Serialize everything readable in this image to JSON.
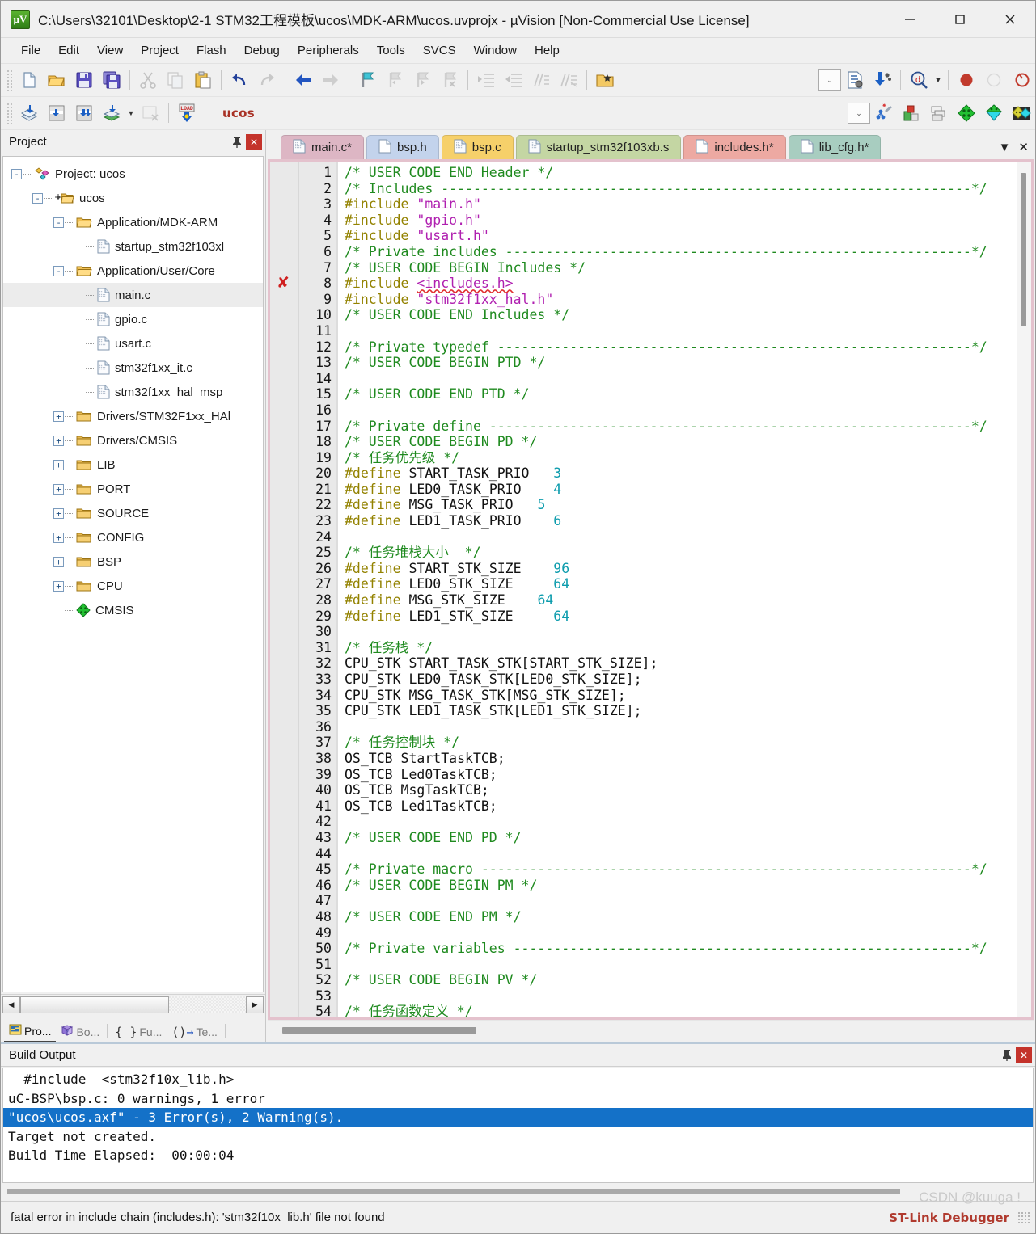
{
  "window": {
    "title": "C:\\Users\\32101\\Desktop\\2-1 STM32工程模板\\ucos\\MDK-ARM\\ucos.uvprojx - µVision  [Non-Commercial Use License]",
    "app_icon_text": "µV",
    "minimize": "—",
    "maximize": "▢",
    "close": "✕"
  },
  "menu": {
    "items": [
      "File",
      "Edit",
      "View",
      "Project",
      "Flash",
      "Debug",
      "Peripherals",
      "Tools",
      "SVCS",
      "Window",
      "Help"
    ]
  },
  "toolbar1": {
    "icons": [
      "new-file-icon",
      "open-folder-icon",
      "save-icon",
      "save-all-icon",
      "cut-icon",
      "copy-icon",
      "paste-icon",
      "undo-icon",
      "redo-icon",
      "navigate-back-icon",
      "navigate-forward-icon",
      "bookmark-toggle-icon",
      "bookmark-prev-icon",
      "bookmark-next-icon",
      "bookmark-clear-icon",
      "indent-icon",
      "outdent-icon",
      "comment-icon",
      "uncomment-icon",
      "open-in-explorer-icon",
      "configure-toolbar-icon",
      "debug-settings-icon",
      "download-icon",
      "find-icon",
      "find-dropdown-icon",
      "start-debug-icon",
      "stop-debug-icon",
      "insert-breakpoint-icon"
    ]
  },
  "toolbar2": {
    "icons": [
      "translate-icon",
      "build-icon",
      "rebuild-icon",
      "batch-build-icon",
      "batch-build-dropdown-icon",
      "stop-build-icon",
      "load-icon"
    ],
    "target_selector_value": "ucos",
    "target_dropdown": "⌄",
    "icons_right": [
      "target-options-icon",
      "manage-project-items-icon",
      "manage-multi-project-icon",
      "pack-installer-icon",
      "manage-runtime-env-icon",
      "pack-manage-icon"
    ]
  },
  "project_panel": {
    "title": "Project",
    "pin_icon": "📌",
    "close_label": "✕",
    "tree": [
      {
        "label": "Project: ucos",
        "depth": 0,
        "expander": "-",
        "icon": "project-icon"
      },
      {
        "label": "ucos",
        "depth": 1,
        "expander": "-",
        "icon": "target-folder-icon"
      },
      {
        "label": "Application/MDK-ARM",
        "depth": 2,
        "expander": "-",
        "icon": "open-folder-icon"
      },
      {
        "label": "startup_stm32f103xl",
        "depth": 3,
        "expander": "",
        "icon": "asm-file-icon"
      },
      {
        "label": "Application/User/Core",
        "depth": 2,
        "expander": "-",
        "icon": "open-folder-icon"
      },
      {
        "label": "main.c",
        "depth": 3,
        "expander": "",
        "icon": "c-file-icon",
        "selected": true
      },
      {
        "label": "gpio.c",
        "depth": 3,
        "expander": "",
        "icon": "c-file-icon"
      },
      {
        "label": "usart.c",
        "depth": 3,
        "expander": "",
        "icon": "c-file-icon"
      },
      {
        "label": "stm32f1xx_it.c",
        "depth": 3,
        "expander": "",
        "icon": "c-file-icon"
      },
      {
        "label": "stm32f1xx_hal_msp",
        "depth": 3,
        "expander": "",
        "icon": "c-file-icon"
      },
      {
        "label": "Drivers/STM32F1xx_HAl",
        "depth": 2,
        "expander": "+",
        "icon": "closed-folder-icon"
      },
      {
        "label": "Drivers/CMSIS",
        "depth": 2,
        "expander": "+",
        "icon": "closed-folder-icon"
      },
      {
        "label": "LIB",
        "depth": 2,
        "expander": "+",
        "icon": "closed-folder-icon"
      },
      {
        "label": "PORT",
        "depth": 2,
        "expander": "+",
        "icon": "closed-folder-icon"
      },
      {
        "label": "SOURCE",
        "depth": 2,
        "expander": "+",
        "icon": "closed-folder-icon"
      },
      {
        "label": "CONFIG",
        "depth": 2,
        "expander": "+",
        "icon": "closed-folder-icon"
      },
      {
        "label": "BSP",
        "depth": 2,
        "expander": "+",
        "icon": "closed-folder-icon"
      },
      {
        "label": "CPU",
        "depth": 2,
        "expander": "+",
        "icon": "closed-folder-icon"
      },
      {
        "label": "CMSIS",
        "depth": 2,
        "expander": "",
        "icon": "cmsis-icon"
      }
    ],
    "bottom_tabs": [
      {
        "label": "Pro...",
        "icon": "project-window-icon",
        "active": true
      },
      {
        "label": "Bo...",
        "icon": "books-icon",
        "active": false
      },
      {
        "label": "Fu...",
        "icon": "functions-icon",
        "active": false
      },
      {
        "label": "Te...",
        "icon": "templates-icon",
        "active": false
      }
    ]
  },
  "editor": {
    "tabs": [
      {
        "label": "main.c*",
        "color": "#ddb6c4",
        "active": true,
        "icon": "c-file-icon"
      },
      {
        "label": "bsp.h",
        "color": "#c3d3ec",
        "active": false,
        "icon": "h-file-icon"
      },
      {
        "label": "bsp.c",
        "color": "#f6d06a",
        "active": false,
        "icon": "c-file-icon"
      },
      {
        "label": "startup_stm32f103xb.s",
        "color": "#c4d6a3",
        "active": false,
        "icon": "asm-file-icon"
      },
      {
        "label": "includes.h*",
        "color": "#eda9a2",
        "active": false,
        "icon": "h-file-icon"
      },
      {
        "label": "lib_cfg.h*",
        "color": "#a8cdc0",
        "active": false,
        "icon": "h-file-icon"
      }
    ],
    "tab_list_button": "▼",
    "tab_close_button": "✕",
    "error_marker_line": 8,
    "first_line": 1,
    "lines": [
      {
        "n": 1,
        "tokens": [
          [
            "cm",
            "/* USER CODE END Header */"
          ]
        ]
      },
      {
        "n": 2,
        "tokens": [
          [
            "cm",
            "/* Includes ------------------------------------------------------------------*/"
          ]
        ]
      },
      {
        "n": 3,
        "tokens": [
          [
            "pp",
            "#include "
          ],
          [
            "str",
            "\"main.h\""
          ]
        ]
      },
      {
        "n": 4,
        "tokens": [
          [
            "pp",
            "#include "
          ],
          [
            "str",
            "\"gpio.h\""
          ]
        ]
      },
      {
        "n": 5,
        "tokens": [
          [
            "pp",
            "#include "
          ],
          [
            "str",
            "\"usart.h\""
          ]
        ]
      },
      {
        "n": 6,
        "tokens": [
          [
            "cm",
            "/* Private includes ----------------------------------------------------------*/"
          ]
        ]
      },
      {
        "n": 7,
        "tokens": [
          [
            "cm",
            "/* USER CODE BEGIN Includes */"
          ]
        ]
      },
      {
        "n": 8,
        "tokens": [
          [
            "pp",
            "#include "
          ],
          [
            "sq",
            "<includes.h>"
          ]
        ]
      },
      {
        "n": 9,
        "tokens": [
          [
            "pp",
            "#include "
          ],
          [
            "str",
            "\"stm32f1xx_hal.h\""
          ]
        ]
      },
      {
        "n": 10,
        "tokens": [
          [
            "cm",
            "/* USER CODE END Includes */"
          ]
        ]
      },
      {
        "n": 11,
        "tokens": []
      },
      {
        "n": 12,
        "tokens": [
          [
            "cm",
            "/* Private typedef -----------------------------------------------------------*/"
          ]
        ]
      },
      {
        "n": 13,
        "tokens": [
          [
            "cm",
            "/* USER CODE BEGIN PTD */"
          ]
        ]
      },
      {
        "n": 14,
        "tokens": []
      },
      {
        "n": 15,
        "tokens": [
          [
            "cm",
            "/* USER CODE END PTD */"
          ]
        ]
      },
      {
        "n": 16,
        "tokens": []
      },
      {
        "n": 17,
        "tokens": [
          [
            "cm",
            "/* Private define ------------------------------------------------------------*/"
          ]
        ]
      },
      {
        "n": 18,
        "tokens": [
          [
            "cm",
            "/* USER CODE BEGIN PD */"
          ]
        ]
      },
      {
        "n": 19,
        "tokens": [
          [
            "cm",
            "/* 任务优先级 */"
          ]
        ]
      },
      {
        "n": 20,
        "tokens": [
          [
            "pp",
            "#define"
          ],
          [
            "",
            " START_TASK_PRIO   "
          ],
          [
            "num",
            "3"
          ]
        ]
      },
      {
        "n": 21,
        "tokens": [
          [
            "pp",
            "#define"
          ],
          [
            "",
            " LED0_TASK_PRIO    "
          ],
          [
            "num",
            "4"
          ]
        ]
      },
      {
        "n": 22,
        "tokens": [
          [
            "pp",
            "#define"
          ],
          [
            "",
            " MSG_TASK_PRIO   "
          ],
          [
            "num",
            "5"
          ]
        ]
      },
      {
        "n": 23,
        "tokens": [
          [
            "pp",
            "#define"
          ],
          [
            "",
            " LED1_TASK_PRIO    "
          ],
          [
            "num",
            "6"
          ]
        ]
      },
      {
        "n": 24,
        "tokens": []
      },
      {
        "n": 25,
        "tokens": [
          [
            "cm",
            "/* 任务堆栈大小  */"
          ]
        ]
      },
      {
        "n": 26,
        "tokens": [
          [
            "pp",
            "#define"
          ],
          [
            "",
            " START_STK_SIZE    "
          ],
          [
            "num",
            "96"
          ]
        ]
      },
      {
        "n": 27,
        "tokens": [
          [
            "pp",
            "#define"
          ],
          [
            "",
            " LED0_STK_SIZE     "
          ],
          [
            "num",
            "64"
          ]
        ]
      },
      {
        "n": 28,
        "tokens": [
          [
            "pp",
            "#define"
          ],
          [
            "",
            " MSG_STK_SIZE    "
          ],
          [
            "num",
            "64"
          ]
        ]
      },
      {
        "n": 29,
        "tokens": [
          [
            "pp",
            "#define"
          ],
          [
            "",
            " LED1_STK_SIZE     "
          ],
          [
            "num",
            "64"
          ]
        ]
      },
      {
        "n": 30,
        "tokens": []
      },
      {
        "n": 31,
        "tokens": [
          [
            "cm",
            "/* 任务栈 */"
          ]
        ]
      },
      {
        "n": 32,
        "tokens": [
          [
            "",
            "CPU_STK START_TASK_STK[START_STK_SIZE];"
          ]
        ]
      },
      {
        "n": 33,
        "tokens": [
          [
            "",
            "CPU_STK LED0_TASK_STK[LED0_STK_SIZE];"
          ]
        ]
      },
      {
        "n": 34,
        "tokens": [
          [
            "",
            "CPU_STK MSG_TASK_STK[MSG_STK_SIZE];"
          ]
        ]
      },
      {
        "n": 35,
        "tokens": [
          [
            "",
            "CPU_STK LED1_TASK_STK[LED1_STK_SIZE];"
          ]
        ]
      },
      {
        "n": 36,
        "tokens": []
      },
      {
        "n": 37,
        "tokens": [
          [
            "cm",
            "/* 任务控制块 */"
          ]
        ]
      },
      {
        "n": 38,
        "tokens": [
          [
            "",
            "OS_TCB StartTaskTCB;"
          ]
        ]
      },
      {
        "n": 39,
        "tokens": [
          [
            "",
            "OS_TCB Led0TaskTCB;"
          ]
        ]
      },
      {
        "n": 40,
        "tokens": [
          [
            "",
            "OS_TCB MsgTaskTCB;"
          ]
        ]
      },
      {
        "n": 41,
        "tokens": [
          [
            "",
            "OS_TCB Led1TaskTCB;"
          ]
        ]
      },
      {
        "n": 42,
        "tokens": []
      },
      {
        "n": 43,
        "tokens": [
          [
            "cm",
            "/* USER CODE END PD */"
          ]
        ]
      },
      {
        "n": 44,
        "tokens": []
      },
      {
        "n": 45,
        "tokens": [
          [
            "cm",
            "/* Private macro -------------------------------------------------------------*/"
          ]
        ]
      },
      {
        "n": 46,
        "tokens": [
          [
            "cm",
            "/* USER CODE BEGIN PM */"
          ]
        ]
      },
      {
        "n": 47,
        "tokens": []
      },
      {
        "n": 48,
        "tokens": [
          [
            "cm",
            "/* USER CODE END PM */"
          ]
        ]
      },
      {
        "n": 49,
        "tokens": []
      },
      {
        "n": 50,
        "tokens": [
          [
            "cm",
            "/* Private variables ---------------------------------------------------------*/"
          ]
        ]
      },
      {
        "n": 51,
        "tokens": []
      },
      {
        "n": 52,
        "tokens": [
          [
            "cm",
            "/* USER CODE BEGIN PV */"
          ]
        ]
      },
      {
        "n": 53,
        "tokens": []
      },
      {
        "n": 54,
        "tokens": [
          [
            "cm",
            "/* 任务函数定义 */"
          ]
        ]
      }
    ]
  },
  "build_output": {
    "title": "Build Output",
    "pin_icon": "📌",
    "close_label": "✕",
    "lines": [
      {
        "text": "  #include  <stm32f10x_lib.h>",
        "selected": false
      },
      {
        "text": "uC-BSP\\bsp.c: 0 warnings, 1 error",
        "selected": false
      },
      {
        "text": "\"ucos\\ucos.axf\" - 3 Error(s), 2 Warning(s).",
        "selected": true
      },
      {
        "text": "Target not created.",
        "selected": false
      },
      {
        "text": "Build Time Elapsed:  00:00:04",
        "selected": false
      }
    ]
  },
  "statusbar": {
    "message": "fatal error in include chain (includes.h): 'stm32f10x_lib.h' file not found",
    "debugger": "ST-Link Debugger"
  },
  "watermark": "CSDN @kuuga !",
  "colors": {
    "accent_selection": "#1471c8",
    "error_red": "#cf2020",
    "comment_green": "#1f8a1f",
    "preproc_olive": "#938200",
    "string_magenta": "#b020b0",
    "number_teal": "#0d9cad",
    "target_red": "#a93226"
  }
}
